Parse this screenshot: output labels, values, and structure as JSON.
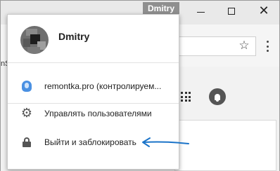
{
  "window": {
    "profile_chip_label": "Dmitry",
    "minimize_icon": "minimize-icon",
    "maximize_icon": "maximize-icon",
    "close_icon": "close-icon"
  },
  "toolbar": {
    "left_edge_text": "nS",
    "bookmark_icon": "star-icon",
    "menu_icon": "vertical-dots-icon"
  },
  "page": {
    "apps_icon": "apps-grid-icon",
    "notification_icon": "bell-icon"
  },
  "profile_menu": {
    "user_name": "Dmitry",
    "items": [
      {
        "label": "remontka.pro (контролируем...",
        "icon": "supervised-user-icon"
      },
      {
        "label": "Управлять пользователями",
        "icon": "gear-icon"
      },
      {
        "label": "Выйти и заблокировать",
        "icon": "lock-icon"
      }
    ]
  },
  "colors": {
    "chip_bg": "#8f8f8f",
    "accent_arrow": "#1a73c8",
    "supervised_icon": "#4a90e2"
  }
}
